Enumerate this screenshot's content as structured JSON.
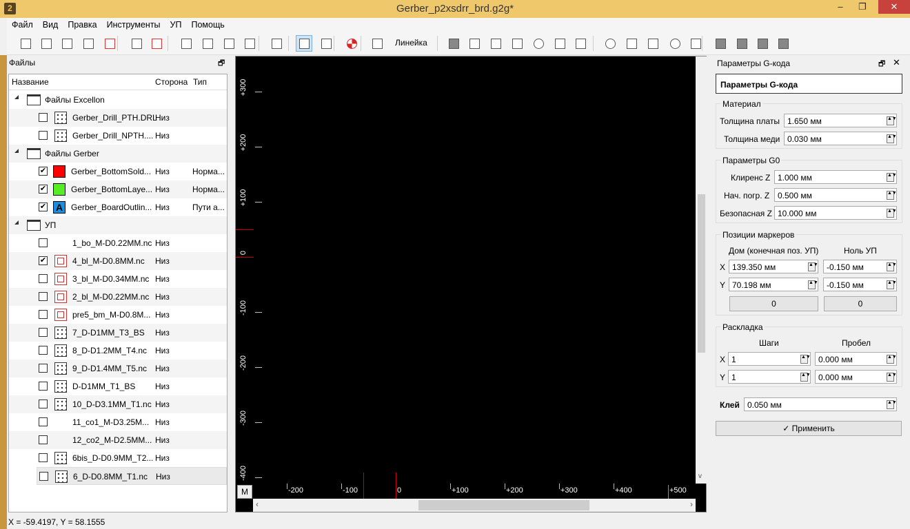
{
  "window": {
    "title": "Gerber_p2xsdrr_brd.g2g*",
    "minimize": "–",
    "maximize": "❐",
    "close": "✕",
    "app_icon": "2"
  },
  "menu": [
    "Файл",
    "Вид",
    "Правка",
    "Инструменты",
    "УП",
    "Помощь"
  ],
  "toolbar": {
    "ruler_label": "Линейка"
  },
  "files_panel": {
    "title": "Файлы",
    "float": "🗗",
    "headers": {
      "name": "Название",
      "side": "Сторона",
      "type": "Тип"
    },
    "rows": [
      {
        "kind": "group",
        "label": "Файлы Excellon"
      },
      {
        "kind": "file",
        "icon": "drill",
        "checked": false,
        "name": "Gerber_Drill_PTH.DRL",
        "side": "Низ",
        "type": ""
      },
      {
        "kind": "file",
        "icon": "drill",
        "checked": false,
        "name": "Gerber_Drill_NPTH....",
        "side": "Низ",
        "type": ""
      },
      {
        "kind": "group",
        "label": "Файлы Gerber"
      },
      {
        "kind": "file",
        "icon": "swatch",
        "color": "#ff0000",
        "checked": true,
        "name": "Gerber_BottomSold...",
        "side": "Низ",
        "type": "Норма..."
      },
      {
        "kind": "file",
        "icon": "swatch",
        "color": "#55ee22",
        "checked": true,
        "name": "Gerber_BottomLaye...",
        "side": "Низ",
        "type": "Норма..."
      },
      {
        "kind": "file",
        "icon": "outline",
        "color": "#1a8fe0",
        "glyph": "A",
        "checked": true,
        "name": "Gerber_BoardOutlin...",
        "side": "Низ",
        "type": "Пути а..."
      },
      {
        "kind": "group",
        "label": "УП"
      },
      {
        "kind": "file",
        "icon": "profile",
        "checked": false,
        "name": "1_bo_M-D0.22MM.nc",
        "side": "Низ",
        "type": ""
      },
      {
        "kind": "file",
        "icon": "mill",
        "checked": true,
        "name": "4_bl_M-D0.8MM.nc",
        "side": "Низ",
        "type": ""
      },
      {
        "kind": "file",
        "icon": "mill",
        "checked": false,
        "name": "3_bl_M-D0.34MM.nc",
        "side": "Низ",
        "type": ""
      },
      {
        "kind": "file",
        "icon": "mill",
        "checked": false,
        "name": "2_bl_M-D0.22MM.nc",
        "side": "Низ",
        "type": ""
      },
      {
        "kind": "file",
        "icon": "mill",
        "checked": false,
        "name": "pre5_bm_M-D0.8M...",
        "side": "Низ",
        "type": ""
      },
      {
        "kind": "file",
        "icon": "drill",
        "checked": false,
        "name": "7_D-D1MM_T3_BS",
        "side": "Низ",
        "type": ""
      },
      {
        "kind": "file",
        "icon": "drill",
        "checked": false,
        "name": "8_D-D1.2MM_T4.nc",
        "side": "Низ",
        "type": ""
      },
      {
        "kind": "file",
        "icon": "drill",
        "checked": false,
        "name": "9_D-D1.4MM_T5.nc",
        "side": "Низ",
        "type": ""
      },
      {
        "kind": "file",
        "icon": "drill",
        "checked": false,
        "name": "D-D1MM_T1_BS",
        "side": "Низ",
        "type": ""
      },
      {
        "kind": "file",
        "icon": "drill",
        "checked": false,
        "name": "10_D-D3.1MM_T1.nc",
        "side": "Низ",
        "type": ""
      },
      {
        "kind": "file",
        "icon": "profile",
        "checked": false,
        "name": "11_co1_M-D3.25M...",
        "side": "Низ",
        "type": ""
      },
      {
        "kind": "file",
        "icon": "profile",
        "checked": false,
        "name": "12_co2_M-D2.5MM...",
        "side": "Низ",
        "type": ""
      },
      {
        "kind": "file",
        "icon": "drill",
        "checked": false,
        "name": "6bis_D-D0.9MM_T2...",
        "side": "Низ",
        "type": ""
      },
      {
        "kind": "file",
        "icon": "drill",
        "checked": false,
        "selected": true,
        "name": "6_D-D0.8MM_T1.nc",
        "side": "Низ",
        "type": ""
      }
    ]
  },
  "status": "X = -59.4197, Y = 58.1555",
  "canvas": {
    "v_ruler": [
      "+300",
      "+200",
      "+100",
      "0",
      "-100",
      "-200",
      "-300",
      "-400"
    ],
    "h_ruler": [
      "-200",
      "-100",
      "0",
      "+100",
      "+200",
      "+300",
      "+400",
      "+500"
    ],
    "m_button": "M"
  },
  "gcode": {
    "dock_title": "Параметры G-кода",
    "header": "Параметры G-кода",
    "material": {
      "title": "Материал",
      "board_label": "Толщина платы",
      "board": "1.650 мм",
      "copper_label": "Толщина меди",
      "copper": "0.030 мм"
    },
    "g0": {
      "title": "Параметры G0",
      "clear_label": "Клиренс Z",
      "clear": "1.000 мм",
      "plunge_label": "Нач. погр. Z",
      "plunge": "0.500 мм",
      "safe_label": "Безопасная Z",
      "safe": "10.000 мм"
    },
    "markers": {
      "title": "Позиции маркеров",
      "home_label": "Дом (конечная поз. УП)",
      "zero_label": "Ноль УП",
      "x": "X",
      "y": "Y",
      "home_x": "139.350 мм",
      "home_y": "70.198 мм",
      "zero_x": "-0.150 мм",
      "zero_y": "-0.150 мм",
      "home_btn": "0",
      "zero_btn": "0"
    },
    "layout": {
      "title": "Раскладка",
      "steps_label": "Шаги",
      "gap_label": "Пробел",
      "x": "X",
      "y": "Y",
      "steps_x": "1",
      "steps_y": "1",
      "gap_x": "0.000 мм",
      "gap_y": "0.000 мм"
    },
    "glue_label": "Клей",
    "glue": "0.050 мм",
    "apply": "✓ Применить"
  }
}
